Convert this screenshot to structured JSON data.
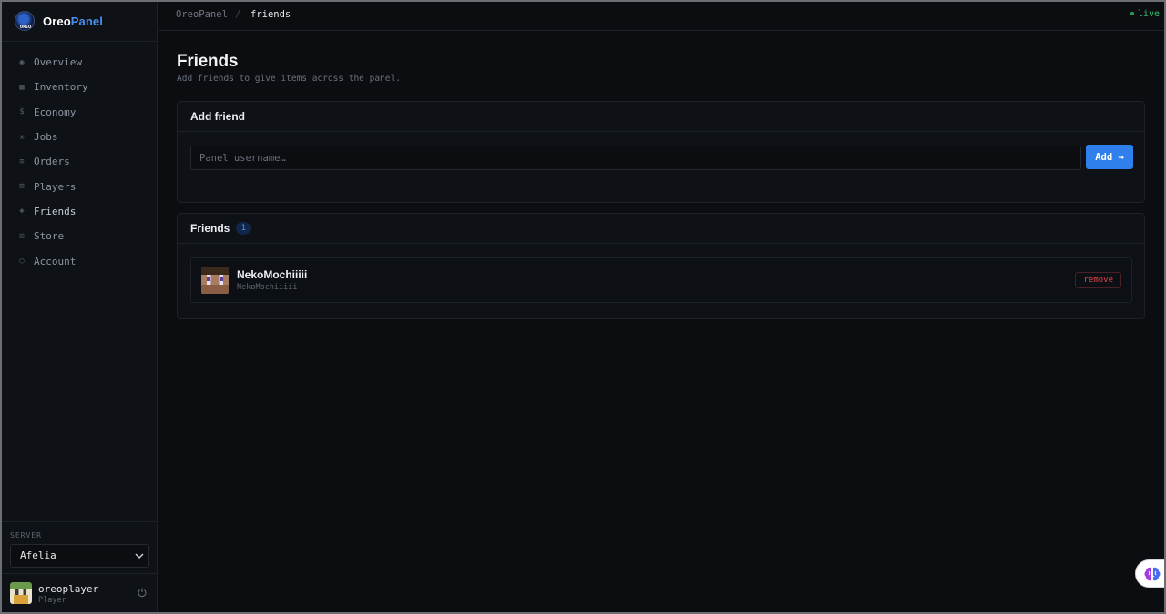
{
  "brand": {
    "name_a": "Oreo",
    "name_b": "Panel",
    "logo_text": "OREO"
  },
  "sidebar": {
    "items": [
      {
        "label": "Overview",
        "icon": "◉"
      },
      {
        "label": "Inventory",
        "icon": "▦"
      },
      {
        "label": "Economy",
        "icon": "$"
      },
      {
        "label": "Jobs",
        "icon": "⚒"
      },
      {
        "label": "Orders",
        "icon": "≡"
      },
      {
        "label": "Players",
        "icon": "⊞"
      },
      {
        "label": "Friends",
        "icon": "◈"
      },
      {
        "label": "Store",
        "icon": "⊡"
      },
      {
        "label": "Account",
        "icon": "○"
      }
    ],
    "server_label": "SERVER",
    "server_value": "Afelia",
    "user": {
      "name": "oreoplayer",
      "role": "Player"
    }
  },
  "topbar": {
    "crumb_root": "OreoPanel",
    "crumb_sep": "/",
    "crumb_current": "friends",
    "status": "live"
  },
  "page": {
    "title": "Friends",
    "subtitle": "Add friends to give items across the panel."
  },
  "add_friend": {
    "heading": "Add friend",
    "placeholder": "Panel username…",
    "button": "Add →"
  },
  "friends_list": {
    "heading": "Friends",
    "count": "1",
    "items": [
      {
        "name": "NekoMochiiiii",
        "sub": "NekoMochiiiii",
        "action": "remove"
      }
    ]
  },
  "colors": {
    "accent": "#2f80ed",
    "live": "#35c46e",
    "danger": "#e5484d"
  }
}
